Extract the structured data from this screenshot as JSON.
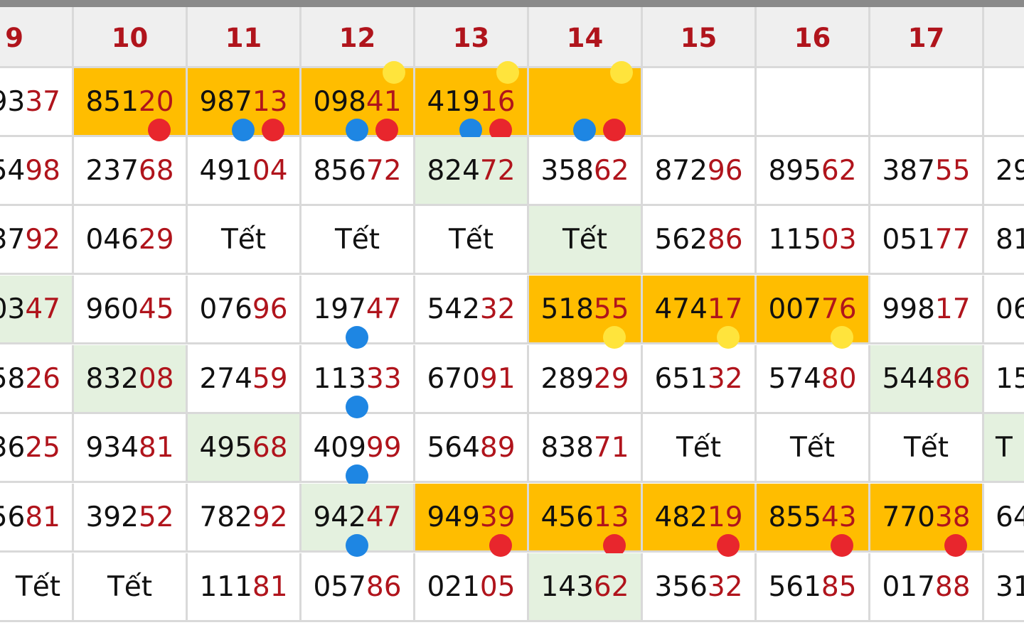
{
  "colors": {
    "header_text": "#b0141c",
    "last_digits": "#b0141c",
    "highlight_orange": "#ffbd00",
    "highlight_green": "#e4f1df",
    "dot_red": "#e8262d",
    "dot_blue": "#1e86e3",
    "dot_yellow": "#ffe43c"
  },
  "header": [
    "9",
    "10",
    "11",
    "12",
    "13",
    "14",
    "15",
    "16",
    "17",
    ""
  ],
  "rows": [
    [
      {
        "text": "9337"
      },
      {
        "text": "85120",
        "bg": "orange",
        "dots": [
          "red-bottom-right"
        ]
      },
      {
        "text": "98713",
        "bg": "orange",
        "dots": [
          "blue-bottom-center",
          "red-bottom-right"
        ]
      },
      {
        "text": "09841",
        "bg": "orange",
        "dots": [
          "yellow-top-right",
          "blue-bottom-center",
          "red-bottom-right"
        ]
      },
      {
        "text": "41916",
        "bg": "orange",
        "dots": [
          "yellow-top-right",
          "red-bottom-right",
          "blue-bottom-center"
        ]
      },
      {
        "text": "",
        "bg": "orange",
        "dots": [
          "yellow-top-right",
          "blue-bottom-center",
          "red-bottom-right"
        ]
      },
      {
        "text": ""
      },
      {
        "text": ""
      },
      {
        "text": ""
      },
      {
        "text": ""
      }
    ],
    [
      {
        "text": "5498"
      },
      {
        "text": "23768"
      },
      {
        "text": "49104"
      },
      {
        "text": "85672"
      },
      {
        "text": "82472",
        "bg": "green"
      },
      {
        "text": "35862"
      },
      {
        "text": "87296"
      },
      {
        "text": "89562"
      },
      {
        "text": "38755"
      },
      {
        "text": "29"
      }
    ],
    [
      {
        "text": "3792"
      },
      {
        "text": "04629"
      },
      {
        "text": "Tết",
        "tet": true
      },
      {
        "text": "Tết",
        "tet": true
      },
      {
        "text": "Tết",
        "tet": true
      },
      {
        "text": "Tết",
        "tet": true,
        "bg": "green"
      },
      {
        "text": "56286"
      },
      {
        "text": "11503"
      },
      {
        "text": "05177"
      },
      {
        "text": "81"
      }
    ],
    [
      {
        "text": "0347",
        "bg": "green"
      },
      {
        "text": "96045"
      },
      {
        "text": "07696"
      },
      {
        "text": "19747",
        "dots": [
          "blue-bottom-center"
        ]
      },
      {
        "text": "54232"
      },
      {
        "text": "51855",
        "bg": "orange",
        "dots": [
          "yellow-bottom-right"
        ]
      },
      {
        "text": "47417",
        "bg": "orange",
        "dots": [
          "yellow-bottom-right"
        ]
      },
      {
        "text": "00776",
        "bg": "orange",
        "dots": [
          "yellow-bottom-right"
        ]
      },
      {
        "text": "99817"
      },
      {
        "text": "06"
      }
    ],
    [
      {
        "text": "5826"
      },
      {
        "text": "83208",
        "bg": "green"
      },
      {
        "text": "27459"
      },
      {
        "text": "11333",
        "dots": [
          "blue-bottom-center"
        ]
      },
      {
        "text": "67091"
      },
      {
        "text": "28929"
      },
      {
        "text": "65132"
      },
      {
        "text": "57480"
      },
      {
        "text": "54486",
        "bg": "green"
      },
      {
        "text": "15"
      }
    ],
    [
      {
        "text": "3625"
      },
      {
        "text": "93481"
      },
      {
        "text": "49568",
        "bg": "green"
      },
      {
        "text": "40999",
        "dots": [
          "blue-bottom-center"
        ]
      },
      {
        "text": "56489"
      },
      {
        "text": "83871"
      },
      {
        "text": "Tết",
        "tet": true
      },
      {
        "text": "Tết",
        "tet": true
      },
      {
        "text": "Tết",
        "tet": true
      },
      {
        "text": "T",
        "tet": true,
        "bg": "green"
      }
    ],
    [
      {
        "text": "5681"
      },
      {
        "text": "39252"
      },
      {
        "text": "78292"
      },
      {
        "text": "94247",
        "bg": "green",
        "dots": [
          "blue-bottom-center"
        ]
      },
      {
        "text": "94939",
        "bg": "orange",
        "dots": [
          "red-bottom-right"
        ]
      },
      {
        "text": "45613",
        "bg": "orange",
        "dots": [
          "red-bottom-right"
        ]
      },
      {
        "text": "48219",
        "bg": "orange",
        "dots": [
          "red-bottom-right"
        ]
      },
      {
        "text": "85543",
        "bg": "orange",
        "dots": [
          "red-bottom-right"
        ]
      },
      {
        "text": "77038",
        "bg": "orange",
        "dots": [
          "red-bottom-right"
        ]
      },
      {
        "text": "64"
      }
    ],
    [
      {
        "text": "Tết",
        "tet": true
      },
      {
        "text": "Tết",
        "tet": true
      },
      {
        "text": "11181"
      },
      {
        "text": "05786"
      },
      {
        "text": "02105"
      },
      {
        "text": "14362",
        "bg": "green"
      },
      {
        "text": "35632"
      },
      {
        "text": "56185"
      },
      {
        "text": "01788"
      },
      {
        "text": "31"
      }
    ]
  ]
}
